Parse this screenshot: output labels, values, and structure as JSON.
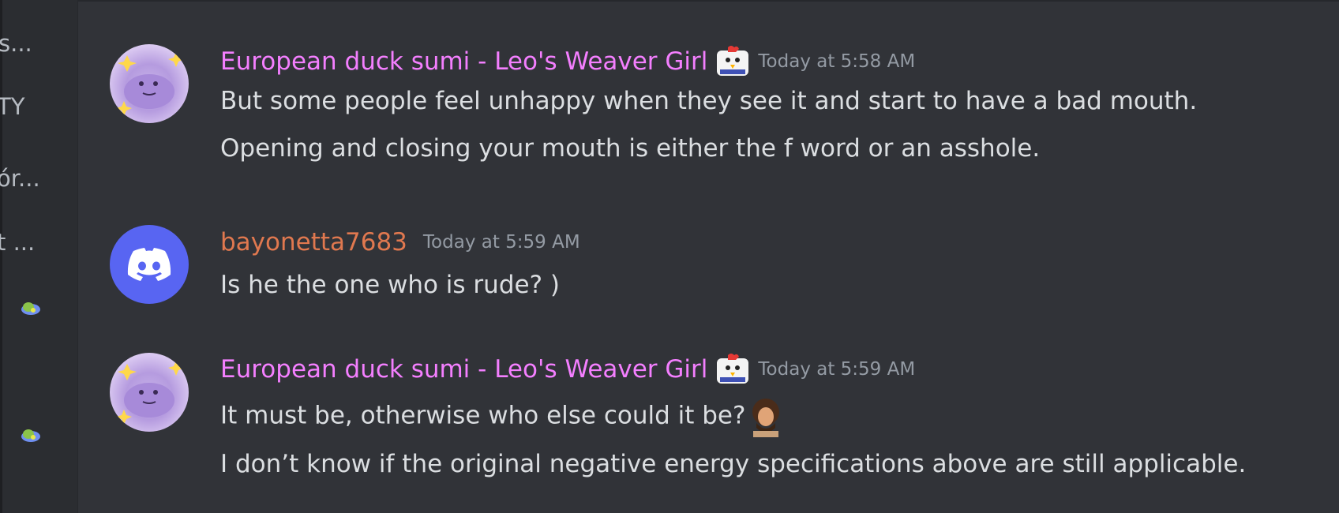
{
  "sidebar": {
    "items": [
      "s...",
      "TY",
      "ór...",
      "t ..."
    ]
  },
  "colors": {
    "pink_name": "#f47fff",
    "orange_name": "#e0784f",
    "message_text": "#dbdee1",
    "timestamp": "#949ba4",
    "discord_blue": "#5865f2"
  },
  "messages": [
    {
      "author": "European duck sumi - Leo's Weaver Girl",
      "timestamp": "Today at 5:58 AM",
      "lines": [
        "But some people feel unhappy when they see it and start to have a bad mouth.",
        "Opening and closing your mouth is either the f word or an asshole."
      ]
    },
    {
      "author": "bayonetta7683",
      "timestamp": "Today at 5:59 AM",
      "lines": [
        "Is he the one who is rude? )"
      ]
    },
    {
      "author": "European duck sumi - Leo's Weaver Girl",
      "timestamp": "Today at 5:59 AM",
      "lines": [
        "It must be, otherwise who else could it be?",
        "I don’t know if the original negative energy specifications above are still applicable."
      ]
    }
  ]
}
